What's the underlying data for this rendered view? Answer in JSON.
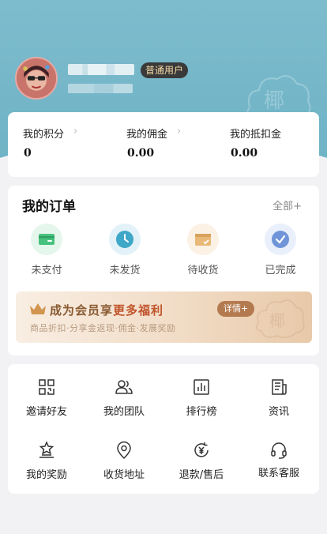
{
  "profile": {
    "role_badge": "普通用户",
    "avatar_icon": "avatar-icon",
    "seal_icon": "cloud-seal-icon",
    "header_color": "#75b7c9"
  },
  "stats": [
    {
      "label": "我的积分",
      "value": "0",
      "has_arrow": true
    },
    {
      "label": "我的佣金",
      "value": "0.00",
      "has_arrow": true
    },
    {
      "label": "我的抵扣金",
      "value": "0.00",
      "has_arrow": false
    }
  ],
  "orders": {
    "title": "我的订单",
    "all_label": "全部+",
    "items": [
      {
        "label": "未支付",
        "icon": "wallet-icon",
        "color": "#48c27e"
      },
      {
        "label": "未发货",
        "icon": "clock-icon",
        "color": "#3fa7c7"
      },
      {
        "label": "待收货",
        "icon": "package-icon",
        "color": "#e9b978"
      },
      {
        "label": "已完成",
        "icon": "check-icon",
        "color": "#6f95d8"
      }
    ]
  },
  "promo": {
    "title_prefix": "成为会员享",
    "title_highlight": "更多福利",
    "subtitle": "商品折扣·分享金返现·佣金·发展奖励",
    "detail_label": "详情+",
    "crown_icon": "crown-icon"
  },
  "tools": [
    {
      "label": "邀请好友",
      "icon": "qr-code-icon"
    },
    {
      "label": "我的团队",
      "icon": "team-icon"
    },
    {
      "label": "排行榜",
      "icon": "ranking-icon"
    },
    {
      "label": "资讯",
      "icon": "news-icon"
    },
    {
      "label": "我的奖励",
      "icon": "award-icon"
    },
    {
      "label": "收货地址",
      "icon": "location-icon"
    },
    {
      "label": "退款/售后",
      "icon": "refund-icon"
    },
    {
      "label": "联系客服",
      "icon": "headset-icon"
    }
  ]
}
